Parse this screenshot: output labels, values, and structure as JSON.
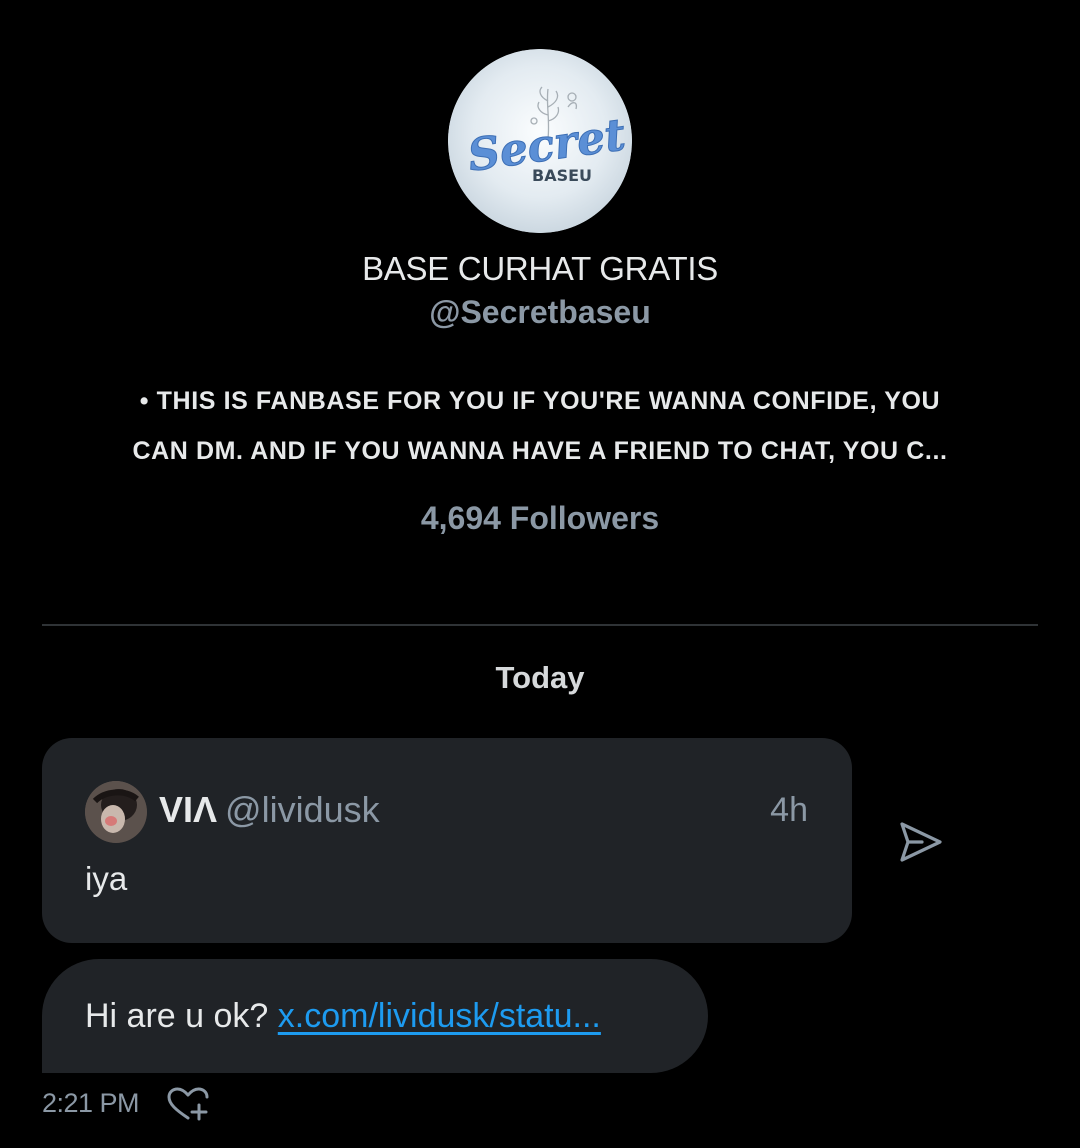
{
  "profile": {
    "avatar_text_main": "Secret",
    "avatar_text_sub": "BASEU",
    "name": "BASE CURHAT GRATIS",
    "handle": "@Secretbaseu",
    "bio_line1": "• THIS IS FANBASE FOR YOU IF YOU'RE WANNA CONFIDE, YOU",
    "bio_line2": "CAN DM. AND IF YOU WANNA HAVE A FRIEND TO CHAT, YOU C...",
    "followers": "4,694 Followers"
  },
  "conversation": {
    "date_label": "Today",
    "shared_post": {
      "author_name": "VIΛ",
      "author_handle": "@lividusk",
      "time": "4h",
      "text": "iya"
    },
    "message": {
      "text": "Hi are u ok?",
      "link": "x.com/lividusk/statu...",
      "time": "2:21 PM"
    }
  },
  "icons": {
    "share": "send-icon",
    "react": "heart-plus-icon"
  },
  "colors": {
    "background": "#000000",
    "bubble": "#202327",
    "muted_text": "#8b98a5",
    "link": "#1d9bf0",
    "avatar_brand": "#5b8fd6"
  }
}
